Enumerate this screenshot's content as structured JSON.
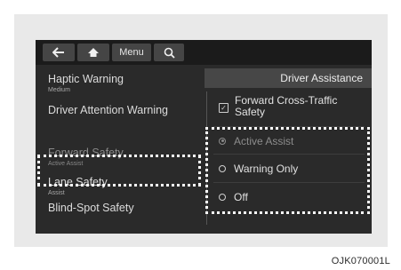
{
  "toolbar": {
    "back_icon": "arrow-left-icon",
    "home_icon": "home-icon",
    "menu_label": "Menu",
    "search_icon": "search-icon"
  },
  "header": {
    "title": "Driver Assistance"
  },
  "left_menu": {
    "items": [
      {
        "label": "Haptic Warning",
        "sub": "Medium"
      },
      {
        "label": "Driver Attention Warning",
        "sub": ""
      },
      {
        "label": "Forward Safety",
        "sub": "Active Assist"
      },
      {
        "label": "Lane Safety",
        "sub": "Assist"
      },
      {
        "label": "Blind-Spot Safety",
        "sub": ""
      }
    ]
  },
  "right_panel": {
    "checkbox": {
      "label": "Forward Cross-Traffic Safety",
      "checked": true
    },
    "options": [
      {
        "label": "Active Assist",
        "selected": true
      },
      {
        "label": "Warning Only",
        "selected": false
      },
      {
        "label": "Off",
        "selected": false
      }
    ]
  },
  "figure_code": "OJK070001L",
  "colors": {
    "screen_bg": "#2a2a2a",
    "topbar_bg": "#1b1b1b",
    "header_bg": "#474747",
    "highlight_border": "#ffffff"
  }
}
